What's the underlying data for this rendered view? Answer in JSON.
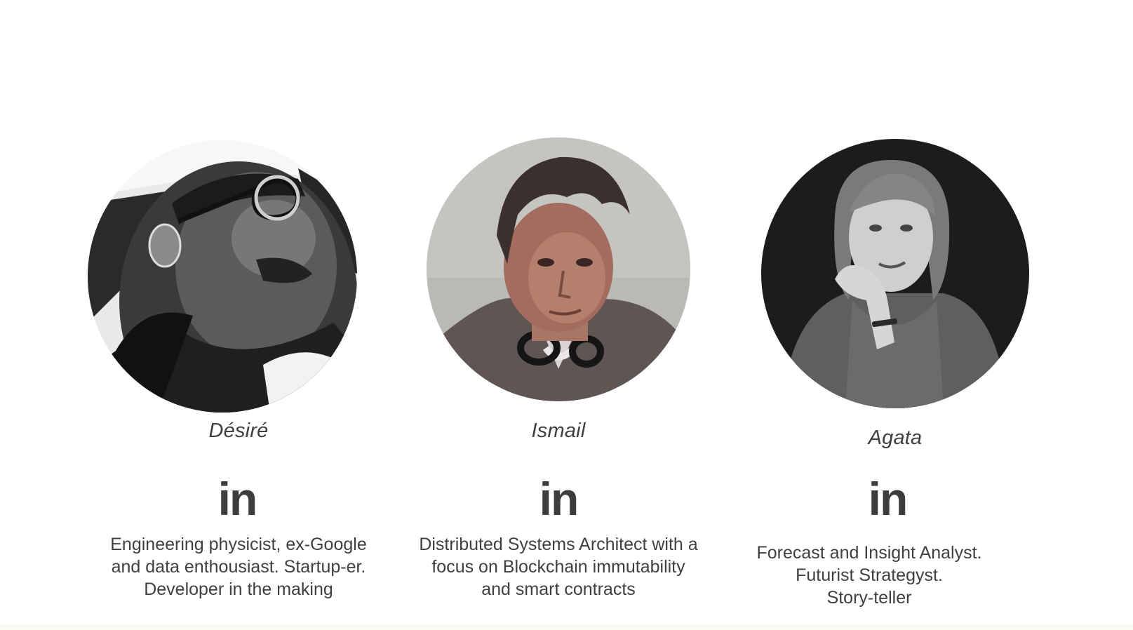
{
  "team": [
    {
      "name": "Désiré",
      "linkedin_label": "in",
      "photo": "portrait-desire",
      "bio_lines": [
        "Engineering physicist, ex-Google",
        "and data enthousiast. Startup-er.",
        "Developer in the making"
      ]
    },
    {
      "name": "Ismail",
      "linkedin_label": "in",
      "photo": "portrait-ismail",
      "bio_lines": [
        "Distributed Systems Architect with a",
        "focus on Blockchain immutability",
        "and smart contracts"
      ]
    },
    {
      "name": "Agata",
      "linkedin_label": "in",
      "photo": "portrait-agata",
      "bio_lines": [
        "Forecast and Insight Analyst.",
        "Futurist Strategyst.",
        "Story-teller"
      ]
    }
  ],
  "colors": {
    "text": "#404040",
    "linkedin_icon": "#3d3d3d",
    "background": "#ffffff"
  }
}
